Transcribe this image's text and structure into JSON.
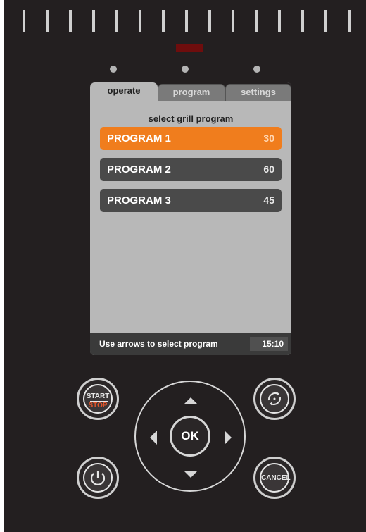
{
  "tabs": [
    {
      "label": "operate",
      "active": true
    },
    {
      "label": "program",
      "active": false
    },
    {
      "label": "settings",
      "active": false
    }
  ],
  "screen": {
    "subtitle": "select grill program",
    "programs": [
      {
        "name": "PROGRAM 1",
        "value": "30",
        "selected": true
      },
      {
        "name": "PROGRAM 2",
        "value": "60",
        "selected": false
      },
      {
        "name": "PROGRAM 3",
        "value": "45",
        "selected": false
      }
    ],
    "status_text": "Use arrows to select program",
    "clock": "15:10"
  },
  "buttons": {
    "start_label": "START",
    "stop_label": "STOP",
    "ok_label": "OK",
    "cancel_label": "CANCEL"
  },
  "colors": {
    "panel": "#231f20",
    "screen_bg": "#b8b8b8",
    "selected_program": "#f07d1d",
    "program_row": "#4a4a4a",
    "stop_red": "#e2562b",
    "status_led_red": "#6e0d0d"
  },
  "icons": [
    "power-icon",
    "refresh-icon",
    "arrow-up-icon",
    "arrow-down-icon",
    "arrow-left-icon",
    "arrow-right-icon"
  ]
}
